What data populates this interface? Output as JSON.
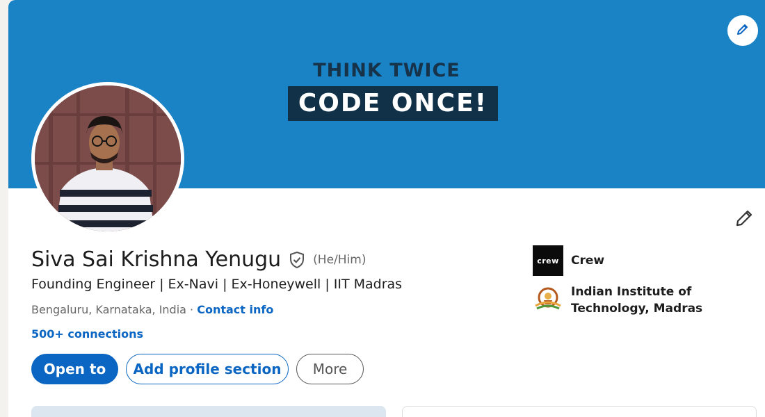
{
  "banner": {
    "line1": "THINK TWICE",
    "line2": "CODE ONCE!",
    "edit_icon": "pencil-icon"
  },
  "profile": {
    "name": "Siva Sai Krishna Yenugu",
    "verified_icon": "shield-check-icon",
    "pronouns": "(He/Him)",
    "headline": "Founding Engineer | Ex-Navi | Ex-Honeywell | IIT Madras",
    "location": "Bengaluru, Karnataka, India",
    "separator": " · ",
    "contact_label": "Contact info",
    "connections": "500+ connections",
    "edit_icon": "pencil-icon"
  },
  "actions": {
    "open_to": "Open to",
    "add_section": "Add profile section",
    "more": "More"
  },
  "organizations": [
    {
      "name": "Crew",
      "logo_text": "crew",
      "logo_icon": "crew-logo"
    },
    {
      "name_line1": "Indian Institute of",
      "name_line2": "Technology, Madras",
      "logo_icon": "iit-madras-logo"
    }
  ],
  "colors": {
    "banner": "#1a83c5",
    "primary": "#0a66c2",
    "text": "#1d1d1d",
    "muted": "#666666"
  }
}
